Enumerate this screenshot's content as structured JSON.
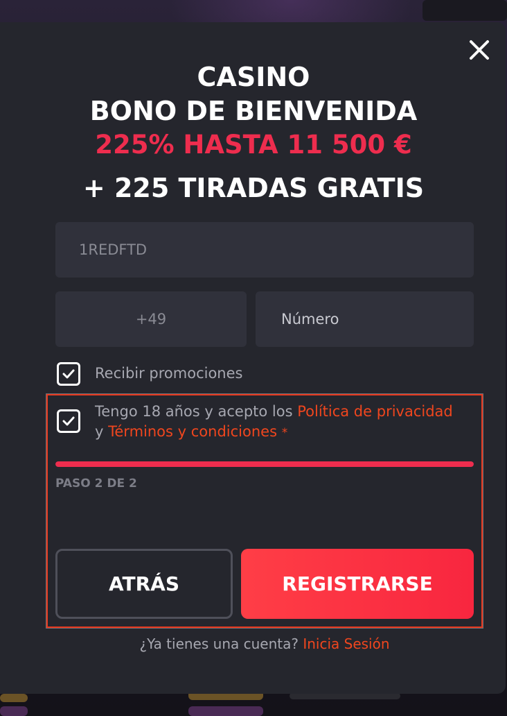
{
  "close_label": "close",
  "title": {
    "line1": "CASINO",
    "line2": "BONO DE BIENVENIDA",
    "bonus": "225% HASTA 11 500 €",
    "free_spins": "+ 225 TIRADAS GRATIS"
  },
  "form": {
    "promo_code_value": "1REDFTD",
    "country_code_value": "+49",
    "phone_placeholder": "Número",
    "promotions_label": "Recibir promociones",
    "promotions_checked": true,
    "terms_checked": true,
    "terms_text_prefix": "Tengo 18 años y acepto los",
    "privacy_link": "Política de privacidad",
    "terms_conjunction": "y",
    "terms_link": "Términos y condiciones",
    "required_mark": "*"
  },
  "progress": {
    "step_label": "PASO 2 DE 2",
    "fraction": 1.0
  },
  "buttons": {
    "back_label": "ATRÁS",
    "register_label": "REGISTRARSE"
  },
  "footer": {
    "question": "¿Ya tienes una cuenta?",
    "login_link": "Inicia Sesión"
  },
  "colors": {
    "accent_red": "#ee2d4e",
    "link_orange": "#f0461e",
    "modal_bg": "#25262d",
    "field_bg": "#30313b"
  }
}
